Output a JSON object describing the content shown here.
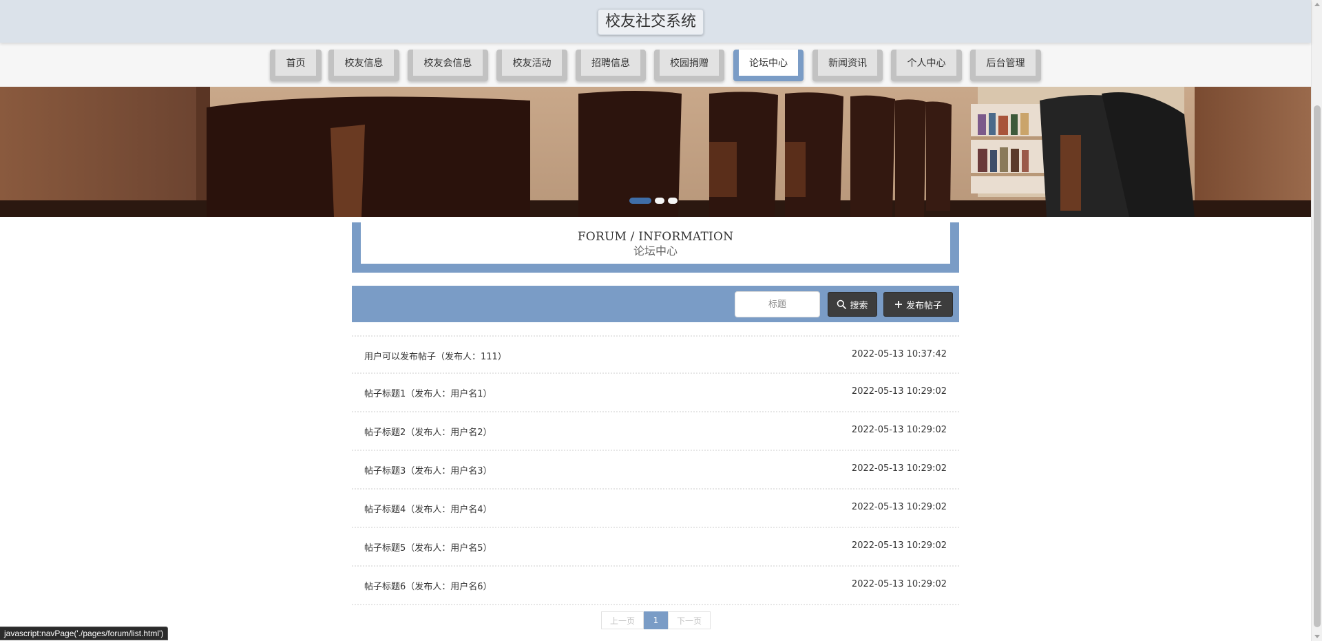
{
  "header": {
    "title": "校友社交系统"
  },
  "nav": {
    "items": [
      {
        "label": "首页",
        "active": false
      },
      {
        "label": "校友信息",
        "active": false
      },
      {
        "label": "校友会信息",
        "active": false
      },
      {
        "label": "校友活动",
        "active": false
      },
      {
        "label": "招聘信息",
        "active": false
      },
      {
        "label": "校园捐赠",
        "active": false
      },
      {
        "label": "论坛中心",
        "active": true
      },
      {
        "label": "新闻资讯",
        "active": false
      },
      {
        "label": "个人中心",
        "active": false
      },
      {
        "label": "后台管理",
        "active": false
      }
    ]
  },
  "banner": {
    "slides": 3,
    "active_slide": 1
  },
  "section": {
    "title_en": "FORUM / INFORMATION",
    "title_cn": "论坛中心"
  },
  "toolbar": {
    "search_placeholder": "标题",
    "search_label": "搜索",
    "add_label": "发布帖子"
  },
  "posts": [
    {
      "title": "用户可以发布帖子（发布人：111）",
      "time": "2022-05-13 10:37:42"
    },
    {
      "title": "帖子标题1（发布人：用户名1）",
      "time": "2022-05-13 10:29:02"
    },
    {
      "title": "帖子标题2（发布人：用户名2）",
      "time": "2022-05-13 10:29:02"
    },
    {
      "title": "帖子标题3（发布人：用户名3）",
      "time": "2022-05-13 10:29:02"
    },
    {
      "title": "帖子标题4（发布人：用户名4）",
      "time": "2022-05-13 10:29:02"
    },
    {
      "title": "帖子标题5（发布人：用户名5）",
      "time": "2022-05-13 10:29:02"
    },
    {
      "title": "帖子标题6（发布人：用户名6）",
      "time": "2022-05-13 10:29:02"
    }
  ],
  "pagination": {
    "prev_label": "上一页",
    "current_page": "1",
    "next_label": "下一页"
  },
  "status_bar": {
    "text": "javascript:navPage('./pages/forum/list.html')"
  },
  "colors": {
    "accent": "#7a9cc6",
    "header_bg": "#dbe2ea",
    "button_dark": "#3d3d3d"
  }
}
